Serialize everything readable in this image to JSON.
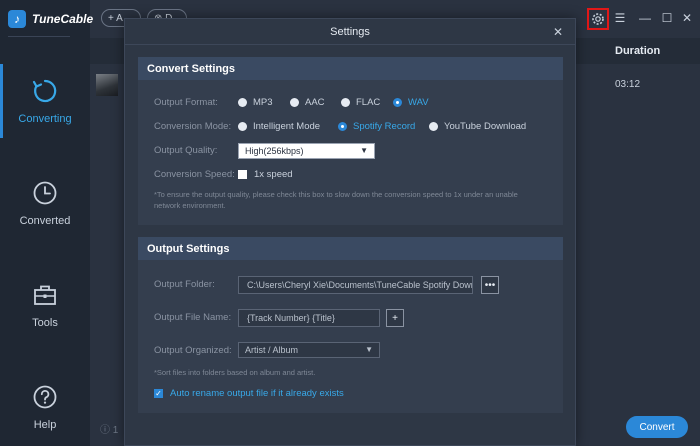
{
  "app": {
    "name": "TuneCable",
    "logo_glyph": "♪",
    "accent": "#2b88d8"
  },
  "sidebar": {
    "items": [
      {
        "label": "Converting",
        "icon": "converting-icon",
        "active": true
      },
      {
        "label": "Converted",
        "icon": "clock-icon",
        "active": false
      },
      {
        "label": "Tools",
        "icon": "toolbox-icon",
        "active": false
      },
      {
        "label": "Help",
        "icon": "help-icon",
        "active": false
      }
    ]
  },
  "toolbar": {
    "add_label": "+ A",
    "delete_label": "⊗ D",
    "window_controls": {
      "menu": "☰",
      "minimize": "—",
      "maximize": "☐",
      "close": "✕"
    }
  },
  "table": {
    "duration_header": "Duration",
    "rows": [
      {
        "duration": "03:12"
      }
    ]
  },
  "bottom": {
    "status": "ⓘ 1",
    "convert_label": "Convert"
  },
  "settings": {
    "title": "Settings",
    "close_glyph": "✕",
    "convert_section": {
      "title": "Convert Settings",
      "output_format_label": "Output Format:",
      "formats": [
        "MP3",
        "AAC",
        "FLAC",
        "WAV"
      ],
      "selected_format": "WAV",
      "conversion_mode_label": "Conversion Mode:",
      "modes": [
        "Intelligent Mode",
        "Spotify Record",
        "YouTube Download"
      ],
      "selected_mode": "Spotify Record",
      "output_quality_label": "Output Quality:",
      "output_quality_value": "High(256kbps)",
      "conversion_speed_label": "Conversion Speed:",
      "speed_option": "1x speed",
      "speed_checked": false,
      "speed_note_line1": "*To ensure the output quality, please check this box to slow down the conversion speed to 1x under an unable",
      "speed_note_line2": "network environment."
    },
    "output_section": {
      "title": "Output Settings",
      "output_folder_label": "Output Folder:",
      "output_folder_value": "C:\\Users\\Cheryl Xie\\Documents\\TuneCable Spotify Downloader",
      "browse_label": "•••",
      "output_file_name_label": "Output File Name:",
      "output_file_name_value": "{Track Number} {Title}",
      "add_label": "+",
      "output_organized_label": "Output Organized:",
      "output_organized_value": "Artist / Album",
      "organized_note": "*Sort files into folders based on album and artist.",
      "auto_rename_label": "Auto rename output file if it already exists",
      "auto_rename_checked": true
    }
  }
}
